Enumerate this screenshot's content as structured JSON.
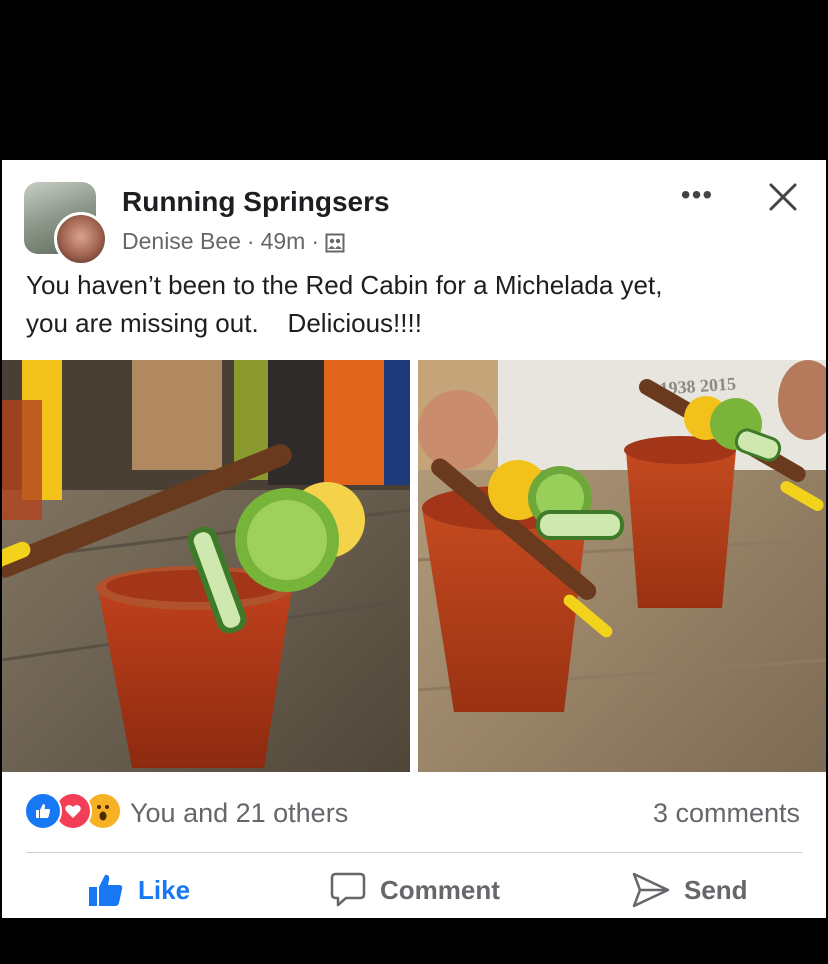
{
  "post": {
    "group_name": "Running Springsers",
    "author": "Denise Bee",
    "separator": "·",
    "time": "49m",
    "text": "You haven’t been to the Red Cabin for a Michelada yet,\nyou are missing out.    Delicious!!!!",
    "photos": [
      {
        "alt": "Michelada with tamarind straw, lime, lemon and cucumber"
      },
      {
        "alt": "Two micheladas on a wooden table"
      }
    ],
    "photo_print": "1938 2015"
  },
  "reactions": {
    "icons": [
      "like-icon",
      "love-icon",
      "wow-icon"
    ],
    "text": "You and 21 others",
    "comments": "3 comments"
  },
  "actions": {
    "like": "Like",
    "comment": "Comment",
    "send": "Send"
  },
  "colors": {
    "accent": "#1877f2",
    "love": "#f33e58",
    "wow": "#f7b125",
    "secondary_text": "#65676b"
  }
}
